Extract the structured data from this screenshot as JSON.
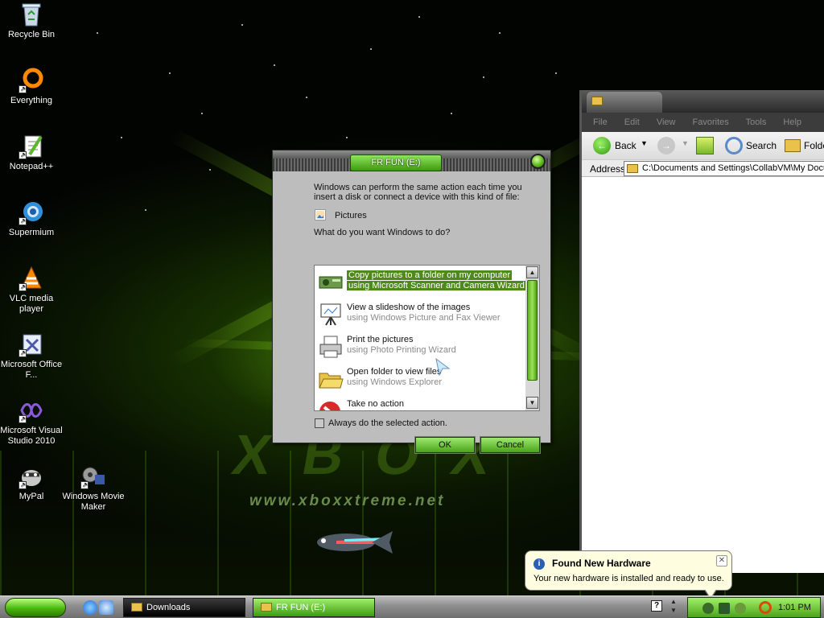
{
  "desktop": {
    "icons": [
      {
        "label": "Recycle Bin",
        "icon": "recycle-bin-icon"
      },
      {
        "label": "Everything",
        "icon": "everything-icon"
      },
      {
        "label": "Notepad++",
        "icon": "notepadpp-icon"
      },
      {
        "label": "Supermium",
        "icon": "supermium-icon"
      },
      {
        "label": "VLC media player",
        "icon": "vlc-icon"
      },
      {
        "label": "Microsoft Office F...",
        "icon": "office-icon"
      },
      {
        "label": "Microsoft Visual Studio 2010",
        "icon": "visual-studio-icon"
      },
      {
        "label": "MyPal",
        "icon": "mypal-icon"
      },
      {
        "label": "Windows Movie Maker",
        "icon": "movie-maker-icon"
      }
    ],
    "wallpaper": {
      "watermark": "XBOX",
      "url": "www.xboxxtreme.net"
    }
  },
  "explorer": {
    "menu": [
      "File",
      "Edit",
      "View",
      "Favorites",
      "Tools",
      "Help"
    ],
    "toolbar": {
      "back": "Back",
      "search": "Search",
      "folders": "Folde"
    },
    "address_label": "Address",
    "address_value": "C:\\Documents and Settings\\CollabVM\\My Docu"
  },
  "dialog": {
    "title": "FR FUN (E:)",
    "intro": "Windows can perform the same action each time you insert a disk or connect a device with this kind of file:",
    "content_type": "Pictures",
    "question": "What do you want Windows to do?",
    "actions": [
      {
        "title": "Copy pictures to a folder on my computer",
        "subtitle": "using Microsoft Scanner and Camera Wizard",
        "icon": "camera-wizard-icon",
        "selected": true
      },
      {
        "title": "View a slideshow of the images",
        "subtitle": "using Windows Picture and Fax Viewer",
        "icon": "slideshow-icon",
        "selected": false
      },
      {
        "title": "Print the pictures",
        "subtitle": "using Photo Printing Wizard",
        "icon": "printer-icon",
        "selected": false
      },
      {
        "title": "Open folder to view files",
        "subtitle": "using Windows Explorer",
        "icon": "folder-icon",
        "selected": false
      },
      {
        "title": "Take no action",
        "subtitle": "",
        "icon": "no-action-icon",
        "selected": false
      }
    ],
    "checkbox_label": "Always do the selected action.",
    "ok": "OK",
    "cancel": "Cancel"
  },
  "balloon": {
    "title": "Found New Hardware",
    "message": "Your new hardware is installed and ready to use."
  },
  "taskbar": {
    "buttons": [
      {
        "label": "Downloads",
        "active": false
      },
      {
        "label": "FR FUN (E:)",
        "active": true
      }
    ],
    "clock": "1:01 PM"
  },
  "colors": {
    "accent_green": "#4aa41a",
    "selection": "#4e8a1a"
  }
}
